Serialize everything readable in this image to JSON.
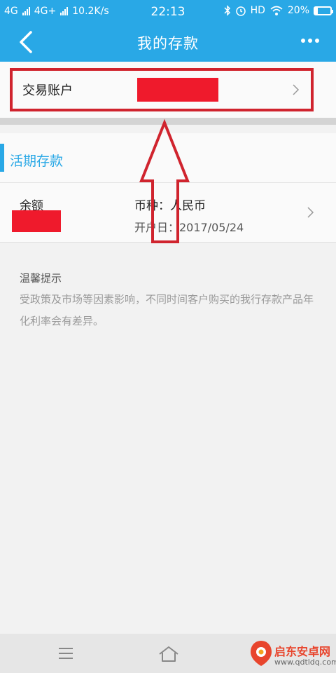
{
  "status_bar": {
    "network_left": "4G",
    "network_right": "4G+",
    "speed": "10.2K/s",
    "time": "22:13",
    "hd_label": "HD",
    "battery_percent": "20%",
    "battery_level": 0.2
  },
  "nav": {
    "title": "我的存款",
    "back_icon": "back-arrow-icon",
    "more_icon": "more-dots-icon"
  },
  "account": {
    "label": "交易账户"
  },
  "section": {
    "title": "活期存款"
  },
  "deposit": {
    "balance_label": "余额",
    "currency": "币种：人民币",
    "open_date": "开户日：2017/05/24"
  },
  "tips": {
    "title": "温馨提示",
    "text": "受政策及市场等因素影响，不同时间客户购买的我行存款产品年化利率会有差异。"
  },
  "colors": {
    "accent": "#29a8e6",
    "annotation_red": "#d0242e",
    "redaction_red": "#ef1a2c"
  },
  "bottom_nav": {
    "menu_icon": "menu-icon",
    "home_icon": "home-icon"
  },
  "watermark": {
    "name": "启东安卓网",
    "url": "www.qdtldq.com"
  }
}
